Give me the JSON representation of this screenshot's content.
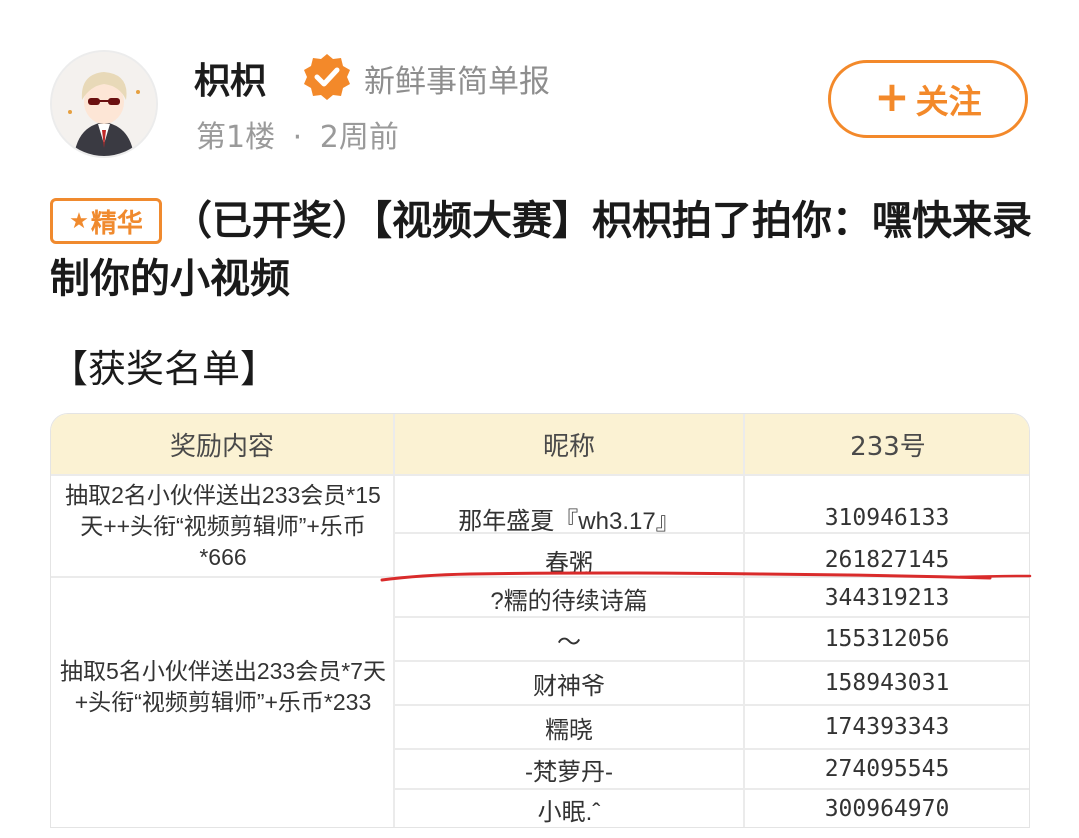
{
  "post": {
    "username": "枳枳",
    "org": "新鲜事简单报",
    "floor": "第1楼",
    "separator": "·",
    "time": "2周前",
    "follow_label": "关注",
    "follow_plus": "+",
    "badge_star": "★",
    "badge_label": "精华",
    "title": "（已开奖）【视频大赛】枳枳拍了拍你：嘿快来录制你的小视频",
    "section_heading": "【获奖名单】"
  },
  "table": {
    "headers": [
      "奖励内容",
      "昵称",
      "233号"
    ],
    "group1": {
      "reward": "抽取2名小伙伴送出233会员*15天++头衔“视频剪辑师”+乐币*666",
      "rows": [
        {
          "nick": "那年盛夏『wh3.17』",
          "id": "310946133"
        },
        {
          "nick": "春粥",
          "id": "261827145"
        }
      ]
    },
    "group2": {
      "reward": "抽取5名小伙伴送出233会员*7天+头衔“视频剪辑师”+乐币*233",
      "rows": [
        {
          "nick": "?糯的待续诗篇",
          "id": "344319213"
        },
        {
          "nick": "～",
          "id": "155312056"
        },
        {
          "nick": "财神爷",
          "id": "158943031"
        },
        {
          "nick": "糯晓",
          "id": "174393343"
        },
        {
          "nick": "-梵萝丹-",
          "id": "274095545"
        },
        {
          "nick": "小眠.ˆ",
          "id": "300964970"
        }
      ]
    }
  },
  "colors": {
    "accent": "#f3892a",
    "header_bg": "#fbf2d3",
    "annotation_red": "#d92b2b"
  },
  "icons": [
    "avatar",
    "verified-badge-icon",
    "plus-icon",
    "star-icon"
  ]
}
